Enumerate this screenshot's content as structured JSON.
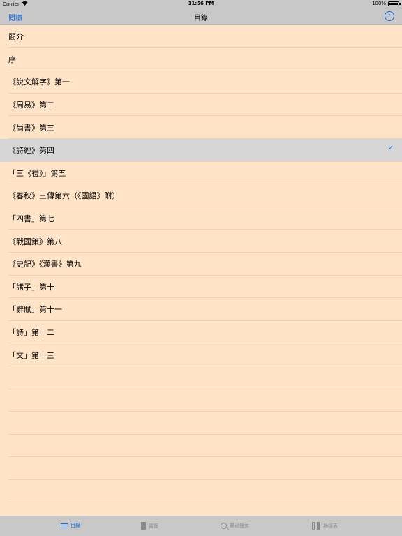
{
  "status_bar": {
    "carrier": "Carrier",
    "time": "11:56 PM",
    "battery": "100%"
  },
  "nav_bar": {
    "back_label": "閱讀",
    "title": "目錄",
    "info_icon": "i"
  },
  "toc": {
    "selected_index": 5,
    "items": [
      {
        "label": "簡介"
      },
      {
        "label": "序"
      },
      {
        "label": "《說文解字》第一"
      },
      {
        "label": "《周易》第二"
      },
      {
        "label": "《尚書》第三"
      },
      {
        "label": "《詩經》第四"
      },
      {
        "label": "「三《禮》」第五"
      },
      {
        "label": "《春秋》三傳第六（《國語》附）"
      },
      {
        "label": "「四書」第七"
      },
      {
        "label": "《戰國策》第八"
      },
      {
        "label": "《史記》《漢書》第九"
      },
      {
        "label": "「諸子」第十"
      },
      {
        "label": "「辭賦」第十一"
      },
      {
        "label": "「詩」第十二"
      },
      {
        "label": "「文」第十三"
      }
    ],
    "check_mark": "✓"
  },
  "tab_bar": {
    "tabs": [
      {
        "label": "目錄",
        "icon": "list-icon",
        "active": true
      },
      {
        "label": "書簽",
        "icon": "bookmark-icon",
        "active": false
      },
      {
        "label": "最近搜索",
        "icon": "search-icon",
        "active": false
      },
      {
        "label": "勘誤表",
        "icon": "compare-icon",
        "active": false
      }
    ]
  },
  "colors": {
    "background": "#ffe4c7",
    "bars": "#c8c8c8",
    "accent": "#1a6fe0",
    "selected_row": "#d6d6d6"
  }
}
